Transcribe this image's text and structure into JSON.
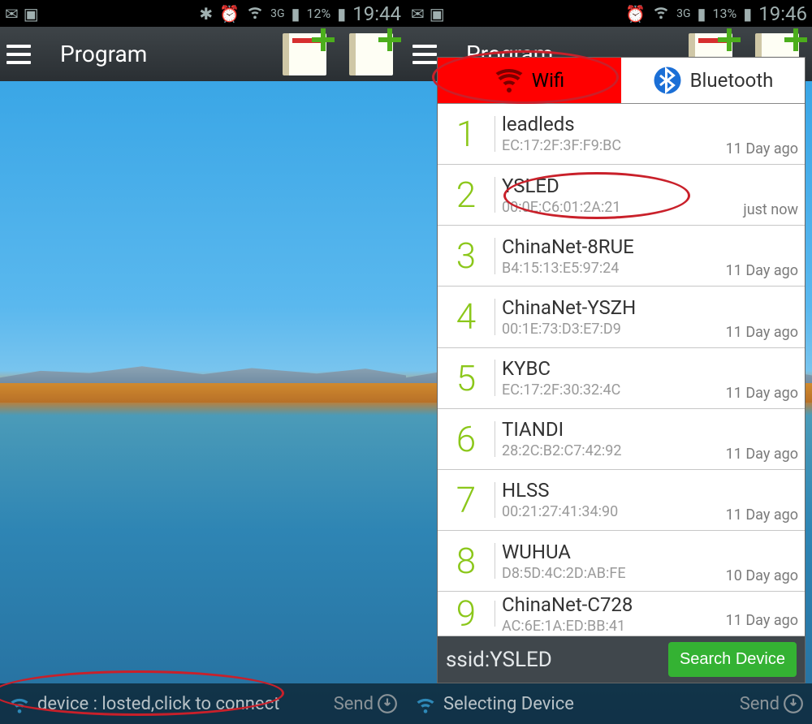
{
  "left": {
    "status": {
      "battery": "12%",
      "net": "3G",
      "time": "19:44"
    },
    "title": "Program",
    "bottom_text": "device : losted,click to connect",
    "send_label": "Send"
  },
  "right": {
    "status": {
      "battery": "13%",
      "net": "3G",
      "time": "19:46"
    },
    "title": "Program",
    "bottom_text": "Selecting Device",
    "send_label": "Send",
    "tabs": {
      "wifi": "Wifi",
      "bluetooth": "Bluetooth"
    },
    "devices": [
      {
        "n": "1",
        "name": "leadleds",
        "mac": "EC:17:2F:3F:F9:BC",
        "ago": "11 Day ago"
      },
      {
        "n": "2",
        "name": "YSLED",
        "mac": "00:0E:C6:01:2A:21",
        "ago": "just now"
      },
      {
        "n": "3",
        "name": "ChinaNet-8RUE",
        "mac": "B4:15:13:E5:97:24",
        "ago": "11 Day ago"
      },
      {
        "n": "4",
        "name": "ChinaNet-YSZH",
        "mac": "00:1E:73:D3:E7:D9",
        "ago": "11 Day ago"
      },
      {
        "n": "5",
        "name": "KYBC",
        "mac": "EC:17:2F:30:32:4C",
        "ago": "11 Day ago"
      },
      {
        "n": "6",
        "name": "TIANDI",
        "mac": "28:2C:B2:C7:42:92",
        "ago": "11 Day ago"
      },
      {
        "n": "7",
        "name": "HLSS",
        "mac": "00:21:27:41:34:90",
        "ago": "11 Day ago"
      },
      {
        "n": "8",
        "name": "WUHUA",
        "mac": "D8:5D:4C:2D:AB:FE",
        "ago": "10 Day ago"
      },
      {
        "n": "9",
        "name": "ChinaNet-C728",
        "mac": "AC:6E:1A:ED:BB:41",
        "ago": "11 Day ago"
      }
    ],
    "ssid_label": "ssid:YSLED",
    "search_label": "Search Device"
  }
}
